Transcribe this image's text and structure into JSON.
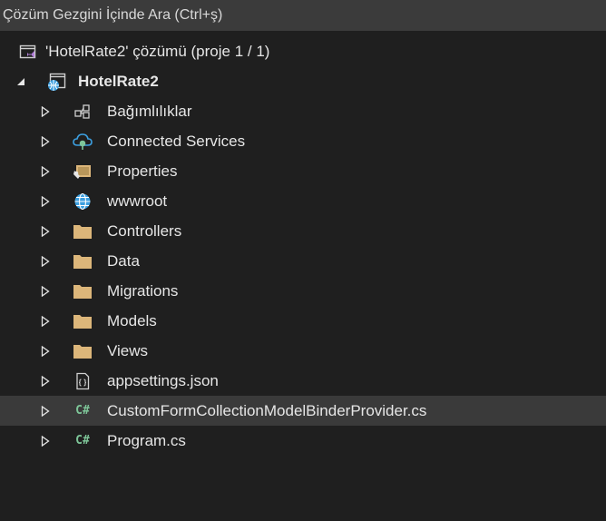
{
  "search": {
    "placeholder_text": "Çözüm Gezgini İçinde Ara (Ctrl+ş)"
  },
  "colors": {
    "background": "#1f1f1f",
    "search_bg": "#3b3b3b",
    "selected_row": "#3a3a3a",
    "folder": "#dcb67a",
    "csharp": "#7ec699",
    "web_blue": "#3c9fe0",
    "solution_purple": "#b180d7"
  },
  "tree": {
    "solution_label": "'HotelRate2' çözümü (proje 1 / 1)",
    "project_label": "HotelRate2",
    "items": [
      {
        "label": "Bağımlılıklar",
        "icon": "dependencies-icon"
      },
      {
        "label": "Connected Services",
        "icon": "connected-services-icon"
      },
      {
        "label": "Properties",
        "icon": "properties-icon"
      },
      {
        "label": "wwwroot",
        "icon": "globe-icon"
      },
      {
        "label": "Controllers",
        "icon": "folder-icon"
      },
      {
        "label": "Data",
        "icon": "folder-icon"
      },
      {
        "label": "Migrations",
        "icon": "folder-icon"
      },
      {
        "label": "Models",
        "icon": "folder-icon"
      },
      {
        "label": "Views",
        "icon": "folder-icon"
      },
      {
        "label": "appsettings.json",
        "icon": "json-file-icon"
      },
      {
        "label": "CustomFormCollectionModelBinderProvider.cs",
        "icon": "csharp-file-icon",
        "selected": true
      },
      {
        "label": "Program.cs",
        "icon": "csharp-file-icon"
      }
    ],
    "csharp_glyph": "C#"
  }
}
